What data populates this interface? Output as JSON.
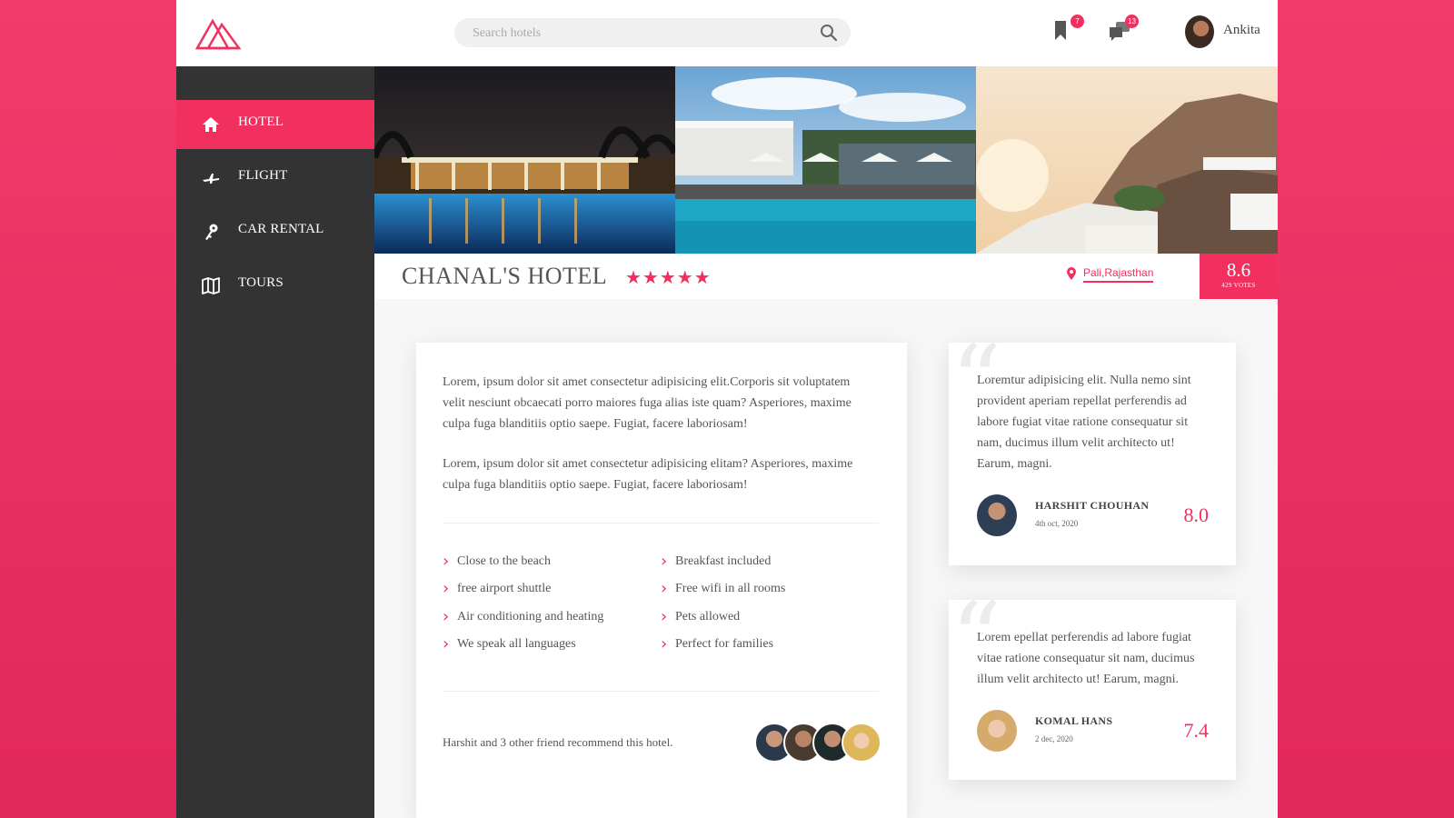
{
  "header": {
    "search_placeholder": "Search hotels",
    "bookmark_count": "7",
    "message_count": "13",
    "user_name": "Ankita"
  },
  "sidebar": {
    "items": [
      {
        "label": "HOTEL",
        "icon": "home-icon",
        "active": true
      },
      {
        "label": "FLIGHT",
        "icon": "plane-icon",
        "active": false
      },
      {
        "label": "CAR RENTAL",
        "icon": "key-icon",
        "active": false
      },
      {
        "label": "TOURS",
        "icon": "map-icon",
        "active": false
      }
    ]
  },
  "hotel": {
    "name": "CHANAL'S HOTEL",
    "stars": "★★★★★",
    "location": "Pali,Rajasthan",
    "score": "8.6",
    "votes": "429 VOTES"
  },
  "description": {
    "paragraphs": [
      "Lorem, ipsum dolor sit amet consectetur adipisicing elit.Corporis sit voluptatem velit nesciunt obcaecati porro maiores fuga alias iste quam? Asperiores, maxime culpa fuga blanditiis optio saepe. Fugiat, facere laboriosam!",
      "Lorem, ipsum dolor sit amet consectetur adipisicing elitam? Asperiores, maxime culpa fuga blanditiis optio saepe. Fugiat, facere laboriosam!"
    ],
    "features_left": [
      "Close to the beach",
      "free airport shuttle",
      "Air conditioning and heating",
      "We speak all languages"
    ],
    "features_right": [
      "Breakfast included",
      "Free wifi in all rooms",
      "Pets allowed",
      "Perfect for families"
    ],
    "recommend_text": "Harshit and 3 other friend recommend this hotel."
  },
  "reviews": [
    {
      "text": "Loremtur adipisicing elit. Nulla nemo sint provident aperiam repellat perferendis ad labore fugiat vitae ratione consequatur sit nam, ducimus illum velit architecto ut! Earum, magni.",
      "name": "HARSHIT CHOUHAN",
      "date": "4th oct, 2020",
      "score": "8.0"
    },
    {
      "text": "Lorem epellat perferendis ad labore fugiat vitae ratione consequatur sit nam, ducimus illum velit architecto ut! Earum, magni.",
      "name": "KOMAL HANS",
      "date": "2 dec, 2020",
      "score": "7.4"
    }
  ],
  "colors": {
    "accent": "#f2305f",
    "sidebar": "#333333",
    "background_gradient": "#f33a6a"
  }
}
